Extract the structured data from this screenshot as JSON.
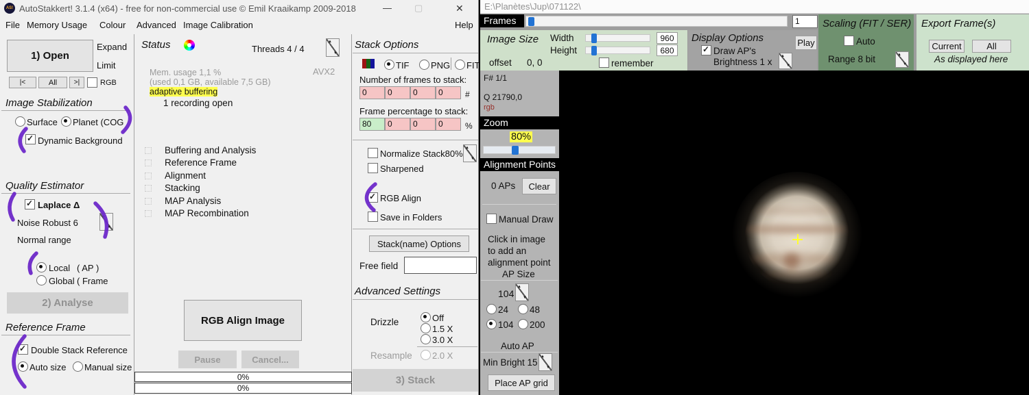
{
  "main": {
    "title_bar": {
      "title": "AutoStakkert! 3.1.4 (x64) - free for non-commercial use © Emil Kraaikamp 2009-2018",
      "icon_label": "AS!",
      "minimize": "—",
      "maximize": "▢",
      "close": "✕"
    },
    "menu": {
      "items": [
        "File",
        "Memory Usage",
        "Colour",
        "Advanced",
        "Image Calibration"
      ],
      "help": "Help"
    },
    "left": {
      "open_button": "1) Open",
      "expand": "Expand",
      "limit": "Limit",
      "nav_first": "|<",
      "nav_all": "All",
      "nav_last": ">|",
      "rgb_label": "RGB",
      "stabilization_title": "Image Stabilization",
      "surface_label": "Surface",
      "planet_label": "Planet (COG",
      "dynamic_bg_label": "Dynamic Background",
      "quality_title": "Quality Estimator",
      "laplace_label": "Laplace Δ",
      "noise_robust_label": "Noise Robust 6",
      "normal_range_label": "Normal range",
      "local_label": "Local",
      "local_suffix": "( AP )",
      "global_label": "Global",
      "global_suffix": "( Frame",
      "analyse_button": "2) Analyse",
      "reference_title": "Reference Frame",
      "double_stack_label": "Double Stack Reference",
      "auto_size_label": "Auto size",
      "manual_size_label": "Manual size"
    },
    "status": {
      "title": "Status",
      "threads": "Threads 4 / 4",
      "avx": "AVX2",
      "mem_line1": "Mem. usage 1,1 %",
      "mem_line2": "(used 0,1 GB, available 7,5 GB)",
      "adaptive": "adaptive buffering",
      "recording": "1 recording open",
      "steps": [
        "Buffering and Analysis",
        "Reference Frame",
        "Alignment",
        "Stacking",
        "MAP Analysis",
        "MAP Recombination"
      ],
      "rgb_align_button": "RGB Align Image",
      "pause_button": "Pause",
      "cancel_button": "Cancel...",
      "progress1": "0%",
      "progress2": "0%"
    },
    "stack": {
      "title": "Stack Options",
      "tif": "TIF",
      "png": "PNG",
      "fit": "FIT",
      "frames_label": "Number of frames to stack:",
      "frames_values": [
        "0",
        "0",
        "0",
        "0"
      ],
      "frames_unit": "#",
      "percent_label": "Frame percentage to stack:",
      "percent_values": [
        "80",
        "0",
        "0",
        "0"
      ],
      "percent_unit": "%",
      "normalize_label": "Normalize Stack80%",
      "sharpened_label": "Sharpened",
      "rgb_align_label": "RGB Align",
      "save_folders_label": "Save in Folders",
      "stackname_button": "Stack(name) Options",
      "free_field_label": "Free field",
      "advanced_title": "Advanced Settings",
      "drizzle_label": "Drizzle",
      "off": "Off",
      "x15": "1.5 X",
      "x30": "3.0 X",
      "resample_label": "Resample",
      "x20": "2.0 X",
      "stack_button": "3) Stack"
    }
  },
  "viewer": {
    "title": "E:\\Planètes\\Jup\\071122\\",
    "frames_label": "Frames",
    "frame_number": "1",
    "image_size": {
      "title": "Image Size",
      "width_label": "Width",
      "width_value": "960",
      "height_label": "Height",
      "height_value": "680",
      "offset_label": "offset",
      "offset_value": "0, 0",
      "remember_label": "remember"
    },
    "display_options": {
      "title": "Display Options",
      "play_button": "Play",
      "draw_aps_label": "Draw AP's",
      "brightness_label": "Brightness 1 x"
    },
    "scaling": {
      "title": "Scaling (FIT / SER)",
      "auto_label": "Auto",
      "range_label": "Range 8 bit"
    },
    "export": {
      "title": "Export Frame(s)",
      "current_button": "Current",
      "all_button": "All",
      "note": "As displayed here"
    },
    "sidebar": {
      "frame_info": "F# 1/1",
      "quality": "Q  21790,0",
      "channels": "rgb",
      "zoom_title": "Zoom",
      "zoom_value": "80%",
      "ap_title": "Alignment Points",
      "ap_count": "0 APs",
      "clear_button": "Clear",
      "manual_draw_label": "Manual Draw",
      "hint_line1": "Click in image",
      "hint_line2": "to add an",
      "hint_line3": "alignment point",
      "ap_size_title": "AP Size",
      "ap_size_value": "104",
      "r24": "24",
      "r48": "48",
      "r104": "104",
      "r200": "200",
      "auto_ap_title": "Auto AP",
      "min_bright_label": "Min Bright  15",
      "place_grid_button": "Place AP grid"
    }
  },
  "colors": {
    "annotation_purple": "#6d28c9",
    "highlight_yellow": "#ffff4e",
    "field_pink": "#f6c5c5",
    "field_green": "#c9eec9",
    "panel_green_light": "#cfe0ca",
    "panel_green_dark": "#6f916f",
    "panel_green_pale": "#cde2cc",
    "slider_blue": "#2273d4"
  }
}
